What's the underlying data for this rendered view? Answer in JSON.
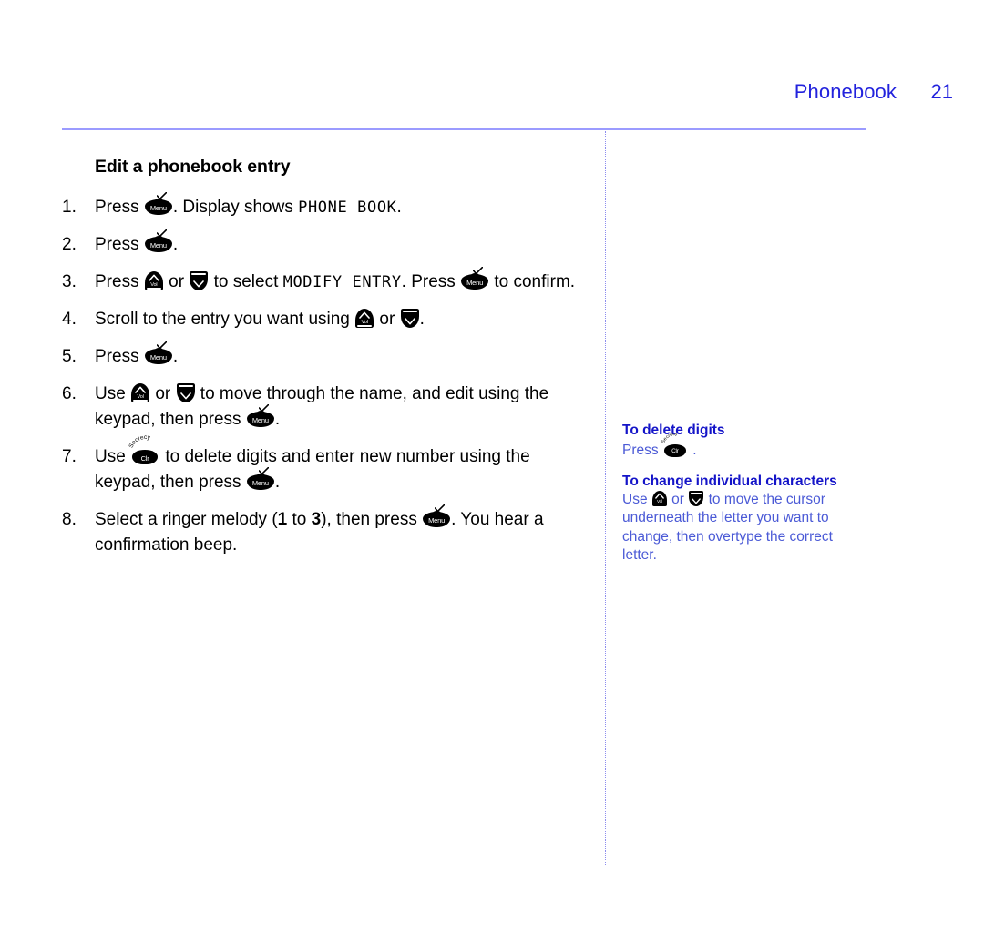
{
  "header": {
    "chapter": "Phonebook",
    "page_number": "21",
    "color": "#2222dd"
  },
  "rule_color": "#9b9bff",
  "divider_color": "#8d8dee",
  "main": {
    "section_title": "Edit a phonebook entry",
    "steps": [
      {
        "num": "1.",
        "parts": [
          {
            "t": "text",
            "v": "Press "
          },
          {
            "t": "key",
            "v": "menu"
          },
          {
            "t": "text",
            "v": ". Display shows "
          },
          {
            "t": "lcd",
            "v": "PHONE BOOK"
          },
          {
            "t": "text",
            "v": "."
          }
        ]
      },
      {
        "num": "2.",
        "parts": [
          {
            "t": "text",
            "v": "Press "
          },
          {
            "t": "key",
            "v": "menu"
          },
          {
            "t": "text",
            "v": "."
          }
        ]
      },
      {
        "num": "3.",
        "parts": [
          {
            "t": "text",
            "v": "Press "
          },
          {
            "t": "key",
            "v": "vol-up"
          },
          {
            "t": "text",
            "v": " or "
          },
          {
            "t": "key",
            "v": "vol-down"
          },
          {
            "t": "text",
            "v": " to select "
          },
          {
            "t": "lcd",
            "v": "MODIFY ENTRY"
          },
          {
            "t": "text",
            "v": ". Press "
          },
          {
            "t": "key",
            "v": "menu"
          },
          {
            "t": "text",
            "v": " to confirm."
          }
        ]
      },
      {
        "num": "4.",
        "parts": [
          {
            "t": "text",
            "v": "Scroll to the entry you want using "
          },
          {
            "t": "key",
            "v": "vol-up"
          },
          {
            "t": "text",
            "v": " or "
          },
          {
            "t": "key",
            "v": "vol-down"
          },
          {
            "t": "text",
            "v": "."
          }
        ]
      },
      {
        "num": "5.",
        "parts": [
          {
            "t": "text",
            "v": "Press "
          },
          {
            "t": "key",
            "v": "menu"
          },
          {
            "t": "text",
            "v": "."
          }
        ]
      },
      {
        "num": "6.",
        "parts": [
          {
            "t": "text",
            "v": "Use "
          },
          {
            "t": "key",
            "v": "vol-up"
          },
          {
            "t": "text",
            "v": " or "
          },
          {
            "t": "key",
            "v": "vol-down"
          },
          {
            "t": "text",
            "v": " to move through the name, and edit using the keypad, then press "
          },
          {
            "t": "key",
            "v": "menu"
          },
          {
            "t": "text",
            "v": "."
          }
        ]
      },
      {
        "num": "7.",
        "parts": [
          {
            "t": "text",
            "v": "Use "
          },
          {
            "t": "key",
            "v": "clr"
          },
          {
            "t": "text",
            "v": " to delete digits and enter new number using the keypad, then press "
          },
          {
            "t": "key",
            "v": "menu"
          },
          {
            "t": "text",
            "v": "."
          }
        ]
      },
      {
        "num": "8.",
        "parts": [
          {
            "t": "text",
            "v": "Select a ringer melody ("
          },
          {
            "t": "bold",
            "v": "1"
          },
          {
            "t": "text",
            "v": " to "
          },
          {
            "t": "bold",
            "v": "3"
          },
          {
            "t": "text",
            "v": "), then press "
          },
          {
            "t": "key",
            "v": "menu"
          },
          {
            "t": "text",
            "v": ". You hear a confirmation beep."
          }
        ]
      }
    ]
  },
  "sidebar": {
    "title_color": "#1414c8",
    "body_color": "#4b5ad6",
    "blocks": [
      {
        "title": "To delete digits",
        "parts": [
          {
            "t": "text",
            "v": "Press "
          },
          {
            "t": "key",
            "v": "clr"
          },
          {
            "t": "text",
            "v": " ."
          }
        ]
      },
      {
        "title": "To change individual characters",
        "parts": [
          {
            "t": "text",
            "v": "Use "
          },
          {
            "t": "key",
            "v": "vol-up"
          },
          {
            "t": "text",
            "v": " or "
          },
          {
            "t": "key",
            "v": "vol-down"
          },
          {
            "t": "text",
            "v": " to move the cursor underneath the letter you want to change, then overtype the correct letter."
          }
        ]
      }
    ]
  },
  "icons": {
    "menu": {
      "label": "Menu",
      "name": "menu-key-icon"
    },
    "clr": {
      "label": "Clr",
      "secondary_label": "Secrecy",
      "name": "clr-key-icon"
    },
    "vol-up": {
      "label": "Vol",
      "name": "volume-up-key-icon"
    },
    "vol-down": {
      "label": "",
      "name": "volume-down-key-icon"
    }
  }
}
